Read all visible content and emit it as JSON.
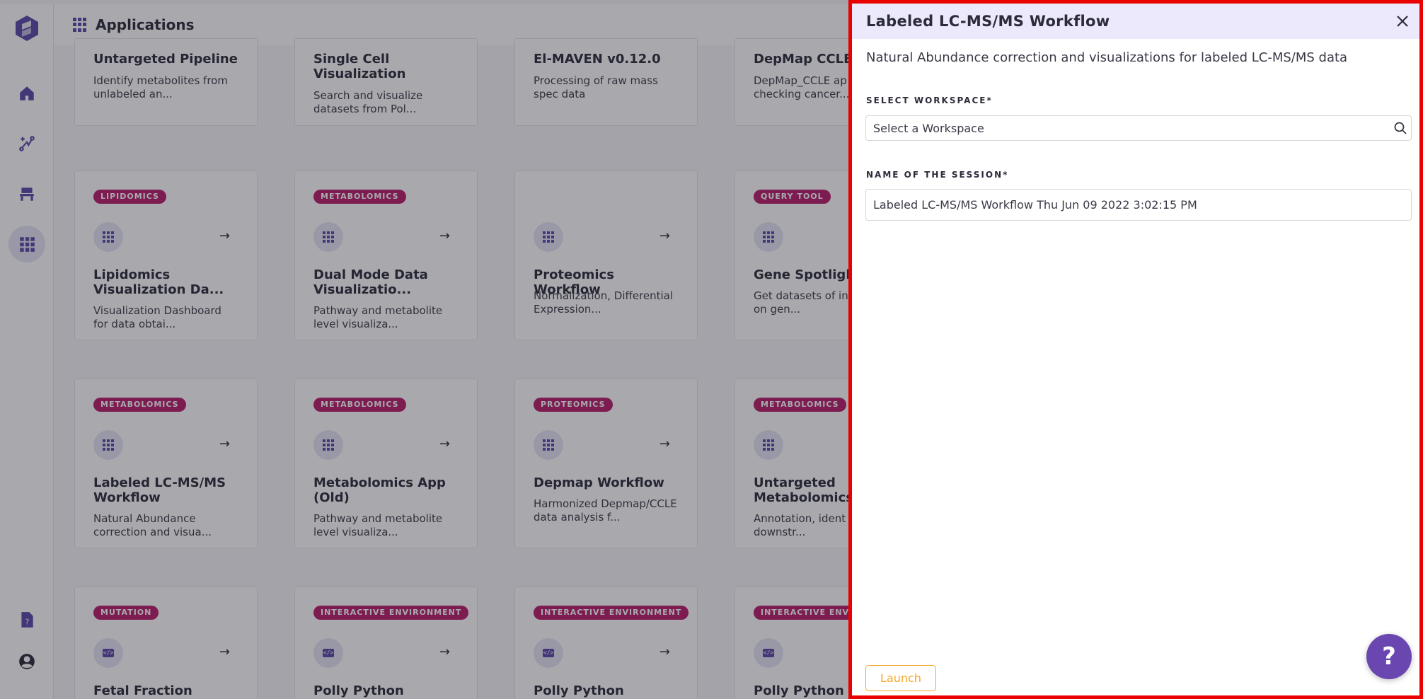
{
  "app": {
    "section_title": "Applications",
    "rail": [
      "home-icon",
      "workflow-icon",
      "workspace-icon",
      "apps-grid-icon",
      "documentation-icon",
      "user-icon"
    ]
  },
  "cards": {
    "row1": [
      {
        "title": "Untargeted Pipeline",
        "desc": "Identify metabolites from unlabeled an..."
      },
      {
        "title": "Single Cell Visualization",
        "desc": "Search and visualize datasets from Pol..."
      },
      {
        "title": "El-MAVEN v0.12.0",
        "desc": "Processing of raw mass spec data"
      },
      {
        "title": "DepMap CCLE",
        "desc": "DepMap_CCLE ap checking cancer..."
      }
    ],
    "row2": [
      {
        "tag": "LIPIDOMICS",
        "title": "Lipidomics Visualization Da...",
        "desc": "Visualization Dashboard for data obtai..."
      },
      {
        "tag": "METABOLOMICS",
        "title": "Dual Mode Data Visualizatio...",
        "desc": "Pathway and metabolite level visualiza..."
      },
      {
        "tag": "",
        "title": "Proteomics Workflow",
        "desc": "Normalization, Differential Expression..."
      },
      {
        "tag": "QUERY TOOL",
        "title": "Gene Spotlight",
        "desc": "Get datasets of in based on gen..."
      }
    ],
    "row3": [
      {
        "tag": "METABOLOMICS",
        "title": "Labeled LC-MS/MS Workflow",
        "desc": "Natural Abundance correction and visua..."
      },
      {
        "tag": "METABOLOMICS",
        "title": "Metabolomics App (Old)",
        "desc": "Pathway and metabolite level visualiza..."
      },
      {
        "tag": "PROTEOMICS",
        "title": "Depmap Workflow",
        "desc": "Harmonized Depmap/CCLE data analysis f..."
      },
      {
        "tag": "METABOLOMICS",
        "title": "Untargeted Metabolomics",
        "desc": "Annotation, ident and downstr..."
      }
    ],
    "row4": [
      {
        "tag": "MUTATION",
        "title": "Fetal Fraction"
      },
      {
        "tag": "INTERACTIVE ENVIRONMENT",
        "title": "Polly Python"
      },
      {
        "tag": "INTERACTIVE ENVIRONMENT",
        "title": "Polly Python"
      },
      {
        "tag": "INTERACTIVE ENVIR",
        "title": "Polly Python"
      }
    ],
    "arrow": "→"
  },
  "drawer": {
    "title": "Labeled LC-MS/MS Workflow",
    "description": "Natural Abundance correction and visualizations for labeled LC-MS/MS data",
    "workspace_label": "SELECT WORKSPACE*",
    "workspace_placeholder": "Select a Workspace",
    "session_label": "NAME OF THE SESSION*",
    "session_value": "Labeled LC-MS/MS Workflow Thu Jun 09 2022 3:02:15 PM",
    "launch_label": "Launch",
    "help_label": "?"
  },
  "colors": {
    "accent": "#5b47a8",
    "tag": "#b81c6b",
    "highlight_border": "#ea0000",
    "launch": "#f5a623",
    "drawer_header": "#ebe9fb"
  }
}
